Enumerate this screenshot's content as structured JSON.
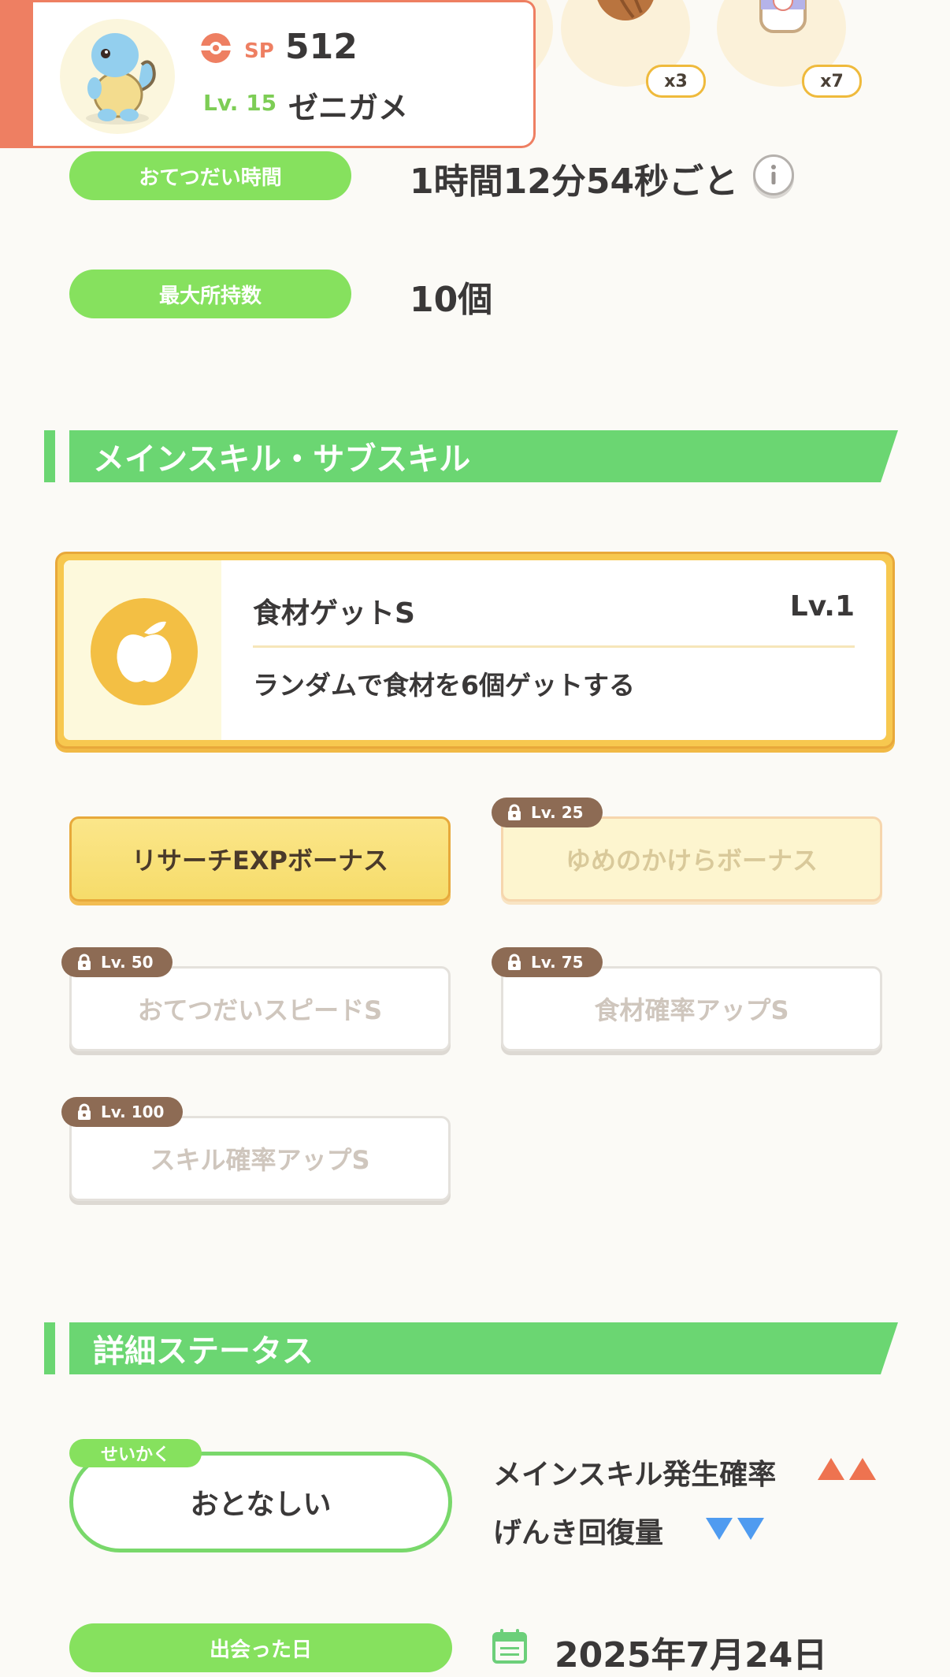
{
  "pokemon": {
    "sp_label": "SP",
    "sp_value": "512",
    "level": "Lv. 15",
    "name": "ゼニガメ"
  },
  "items": [
    {
      "name": "cacao-icon",
      "count": "x3"
    },
    {
      "name": "milk-bottle-icon",
      "count": "x7"
    }
  ],
  "help": {
    "interval_label": "おてつだい時間",
    "interval_value": "1時間12分54秒ごと",
    "max_carry_label": "最大所持数",
    "max_carry_value": "10個"
  },
  "skills_section": {
    "title": "メインスキル・サブスキル",
    "main_skill": {
      "name": "食材ゲットS",
      "level": "Lv.1",
      "description": "ランダムで食材を6個ゲットする",
      "icon": "apple-icon"
    },
    "sub_skills": [
      {
        "label": "リサーチEXPボーナス",
        "state": "active"
      },
      {
        "label": "ゆめのかけらボーナス",
        "state": "unlockable",
        "unlock_level": "Lv. 25"
      },
      {
        "label": "おてつだいスピードS",
        "state": "locked",
        "unlock_level": "Lv. 50"
      },
      {
        "label": "食材確率アップS",
        "state": "locked",
        "unlock_level": "Lv. 75"
      },
      {
        "label": "スキル確率アップS",
        "state": "locked",
        "unlock_level": "Lv. 100"
      }
    ]
  },
  "details_section": {
    "title": "詳細ステータス",
    "nature_tag": "せいかく",
    "nature_value": "おとなしい",
    "effects": [
      {
        "label": "メインスキル発生確率",
        "direction": "up"
      },
      {
        "label": "げんき回復量",
        "direction": "down"
      }
    ],
    "met_date_label": "出会った日",
    "met_date_value": "2025年7月24日"
  },
  "colors": {
    "accent_green": "#6bd672",
    "pill_green": "#86e15e",
    "pokemon_card_accent": "#ee7f62",
    "up_arrow": "#ee7350",
    "down_arrow": "#4f9bf0",
    "gold": "#f3bf44"
  }
}
